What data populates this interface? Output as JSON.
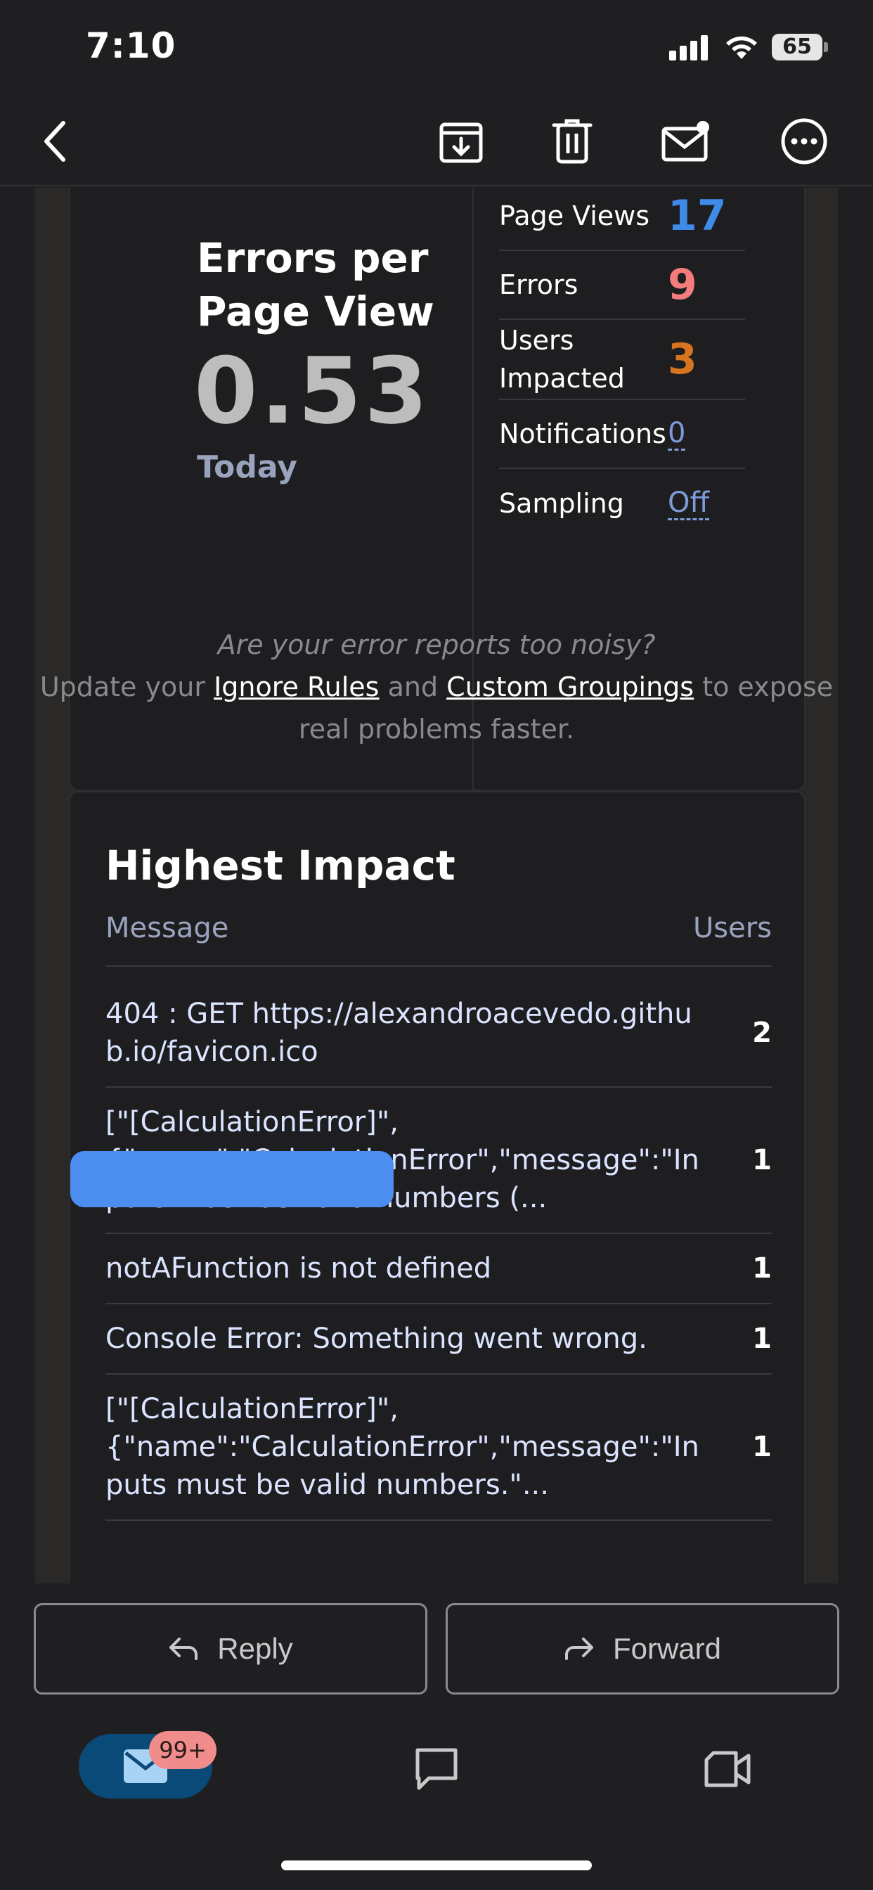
{
  "status_bar": {
    "time": "7:10",
    "battery": "65"
  },
  "toolbar": {
    "icons": [
      "back-icon",
      "archive-icon",
      "trash-icon",
      "mail-unread-icon",
      "more-icon"
    ]
  },
  "stats": {
    "title": "Errors per Page View",
    "value": "0.53",
    "period": "Today",
    "rows": [
      {
        "label": "Page Views",
        "value": "17",
        "color": "#3f8ce8"
      },
      {
        "label": "Errors",
        "value": "9",
        "color": "#f47c7c"
      },
      {
        "label": "Users Impacted",
        "value": "3",
        "color": "#d9741e"
      },
      {
        "label": "Notifications",
        "value": "0",
        "color": "#7e9ad8"
      },
      {
        "label": "Sampling",
        "value": "Off",
        "color": "#7e9ad8"
      }
    ]
  },
  "noisy": {
    "question": "Are your error reports too noisy?",
    "prefix": "Update your",
    "link1": "Ignore Rules",
    "mid": "and",
    "link2": "Custom Groupings",
    "suffix": "to expose real problems faster."
  },
  "impact": {
    "title": "Highest Impact",
    "col_message": "Message",
    "col_users": "Users",
    "rows": [
      {
        "message": "404 : GET https://alexandroacevedo.github.io/favicon.ico",
        "users": "2"
      },
      {
        "message": "[\"[CalculationError]\",{\"name\":\"CalculationError\",\"message\":\"Inputs must be valid numbers (...",
        "users": "1"
      },
      {
        "message": "notAFunction is not defined",
        "users": "1"
      },
      {
        "message": "Console Error: Something went wrong.",
        "users": "1"
      },
      {
        "message": "[\"[CalculationError]\",{\"name\":\"CalculationError\",\"message\":\"Inputs must be valid numbers.\"...",
        "users": "1"
      }
    ]
  },
  "actions": {
    "reply": "Reply",
    "forward": "Forward"
  },
  "tabbar": {
    "mail_badge": "99+"
  }
}
